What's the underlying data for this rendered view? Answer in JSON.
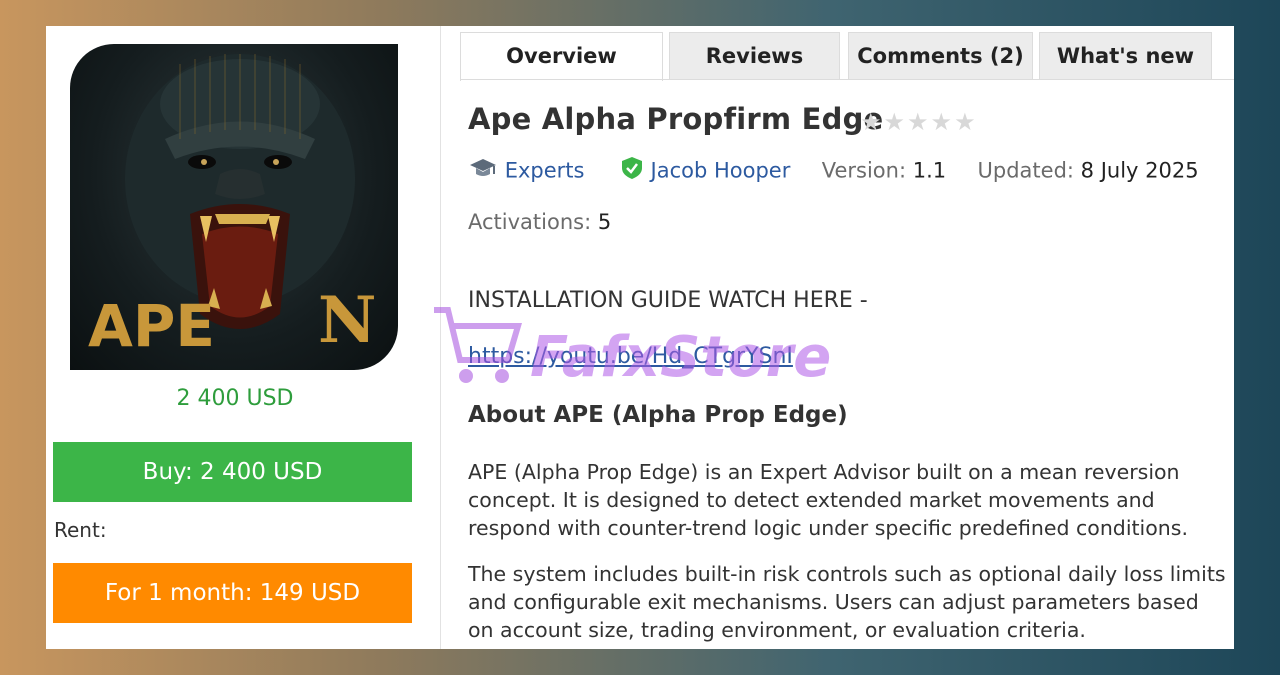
{
  "product": {
    "image_text_left": "APE",
    "image_text_right": "N",
    "price": "2 400 USD",
    "buy_label": "Buy: 2 400 USD",
    "rent_label": "Rent:",
    "rent_option_label": "For 1 month: 149 USD"
  },
  "tabs": [
    {
      "label": "Overview",
      "active": true
    },
    {
      "label": "Reviews",
      "active": false
    },
    {
      "label": "Comments (2)",
      "active": false
    },
    {
      "label": "What's new",
      "active": false
    }
  ],
  "header": {
    "title": "Ape Alpha Propfirm Edge",
    "rating_stars": 0,
    "rating_max": 5
  },
  "meta": {
    "category": "Experts",
    "author": "Jacob Hooper",
    "version_label": "Version:",
    "version": "1.1",
    "updated_label": "Updated:",
    "updated": "8 July 2025",
    "activations_label": "Activations:",
    "activations": "5"
  },
  "description": {
    "install_heading": "INSTALLATION GUIDE WATCH HERE -",
    "video_url": "https://youtu.be/Hd_CTgrYSnI",
    "about_heading": "About APE (Alpha Prop Edge)",
    "paragraph1": "APE (Alpha Prop Edge) is an Expert Advisor built on a mean reversion concept. It is designed to detect extended market movements and respond with counter-trend logic under specific predefined conditions.",
    "paragraph2": "The system includes built-in risk controls such as optional daily loss limits and configurable exit mechanisms. Users can adjust parameters based on account size, trading environment, or evaluation criteria."
  },
  "watermark": {
    "text": "FafxStore"
  },
  "colors": {
    "price_green": "#2e9d3c",
    "buy_green": "#3cb548",
    "rent_orange": "#ff8a00",
    "link_blue": "#2d5aa0",
    "verified_green": "#3cb548"
  }
}
